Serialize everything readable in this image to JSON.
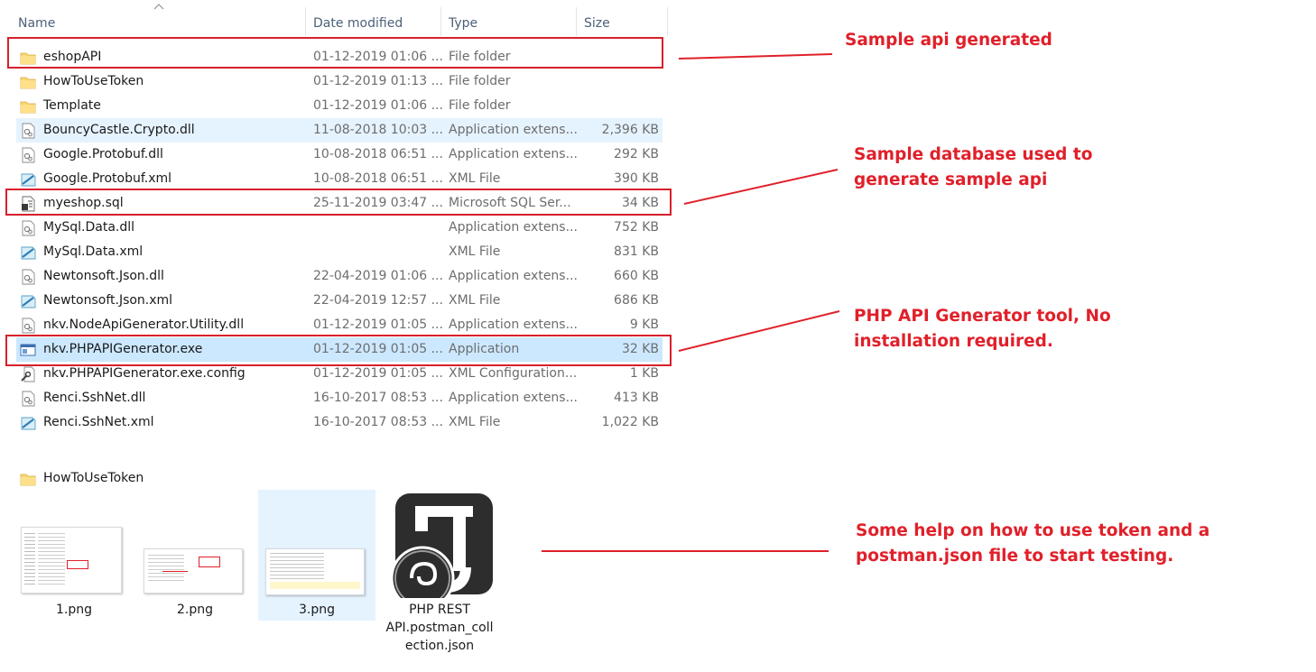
{
  "columns": {
    "name": "Name",
    "date": "Date modified",
    "type": "Type",
    "size": "Size"
  },
  "files": [
    {
      "name": "eshopAPI",
      "date": "01-12-2019 01:06 ...",
      "type": "File folder",
      "size": "",
      "icon": "folder-icon"
    },
    {
      "name": "HowToUseToken",
      "date": "01-12-2019 01:13 ...",
      "type": "File folder",
      "size": "",
      "icon": "folder-icon"
    },
    {
      "name": "Template",
      "date": "01-12-2019 01:06 ...",
      "type": "File folder",
      "size": "",
      "icon": "folder-icon"
    },
    {
      "name": "BouncyCastle.Crypto.dll",
      "date": "11-08-2018 10:03 ...",
      "type": "Application extens...",
      "size": "2,396 KB",
      "icon": "dll-icon"
    },
    {
      "name": "Google.Protobuf.dll",
      "date": "10-08-2018 06:51 ...",
      "type": "Application extens...",
      "size": "292 KB",
      "icon": "dll-icon"
    },
    {
      "name": "Google.Protobuf.xml",
      "date": "10-08-2018 06:51 ...",
      "type": "XML File",
      "size": "390 KB",
      "icon": "xml-icon"
    },
    {
      "name": "myeshop.sql",
      "date": "25-11-2019 03:47 ...",
      "type": "Microsoft SQL Ser...",
      "size": "34 KB",
      "icon": "sql-icon"
    },
    {
      "name": "MySql.Data.dll",
      "date": "",
      "type": "Application extens...",
      "size": "752 KB",
      "icon": "dll-icon"
    },
    {
      "name": "MySql.Data.xml",
      "date": "",
      "type": "XML File",
      "size": "831 KB",
      "icon": "xml-icon"
    },
    {
      "name": "Newtonsoft.Json.dll",
      "date": "22-04-2019 01:06 ...",
      "type": "Application extens...",
      "size": "660 KB",
      "icon": "dll-icon"
    },
    {
      "name": "Newtonsoft.Json.xml",
      "date": "22-04-2019 12:57 ...",
      "type": "XML File",
      "size": "686 KB",
      "icon": "xml-icon"
    },
    {
      "name": "nkv.NodeApiGenerator.Utility.dll",
      "date": "01-12-2019 01:05 ...",
      "type": "Application extens...",
      "size": "9 KB",
      "icon": "dll-icon"
    },
    {
      "name": "nkv.PHPAPIGenerator.exe",
      "date": "01-12-2019 01:05 ...",
      "type": "Application",
      "size": "32 KB",
      "icon": "exe-icon"
    },
    {
      "name": "nkv.PHPAPIGenerator.exe.config",
      "date": "01-12-2019 01:05 ...",
      "type": "XML Configuration...",
      "size": "1 KB",
      "icon": "config-icon"
    },
    {
      "name": "Renci.SshNet.dll",
      "date": "16-10-2017 08:53 ...",
      "type": "Application extens...",
      "size": "413 KB",
      "icon": "dll-icon"
    },
    {
      "name": "Renci.SshNet.xml",
      "date": "16-10-2017 08:53 ...",
      "type": "XML File",
      "size": "1,022 KB",
      "icon": "xml-icon"
    }
  ],
  "second_folder": {
    "name": "HowToUseToken"
  },
  "tiles": [
    {
      "label": "1.png",
      "icon": "image-thumbnail"
    },
    {
      "label": "2.png",
      "icon": "image-thumbnail"
    },
    {
      "label": "3.png",
      "icon": "image-thumbnail"
    },
    {
      "label": "PHP REST API.postman_coll ection.json",
      "label_lines": [
        "PHP REST",
        "API.postman_coll",
        "ection.json"
      ],
      "icon": "json-file-icon"
    }
  ],
  "annotations": {
    "a1": "Sample api generated",
    "a2_line1": "Sample database used to",
    "a2_line2": "generate sample api",
    "a3_line1": "PHP API Generator tool, No",
    "a3_line2": "installation required.",
    "a4_line1": "Some help on how to use token and a",
    "a4_line2": "postman.json file to start testing."
  },
  "colors": {
    "annotation": "#e0202a",
    "selection": "#cce8ff",
    "hover": "#e5f3ff",
    "folder": "#f8d775"
  }
}
